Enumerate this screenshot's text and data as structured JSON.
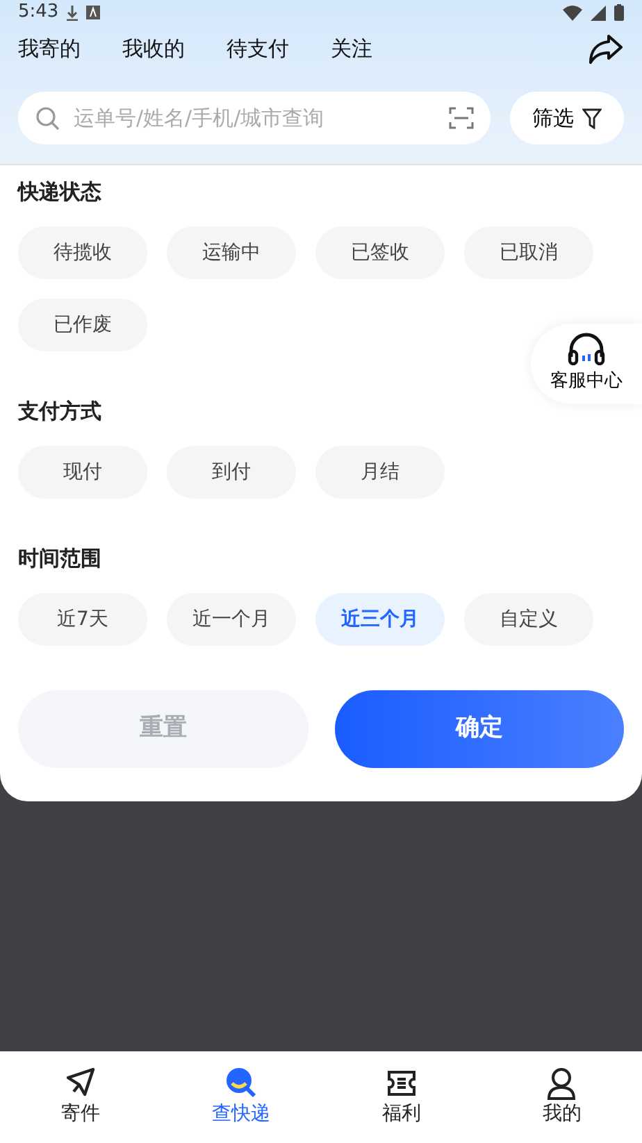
{
  "status_bar": {
    "time": "5:43"
  },
  "tabs": [
    {
      "label": "我寄的"
    },
    {
      "label": "我收的"
    },
    {
      "label": "待支付"
    },
    {
      "label": "关注"
    }
  ],
  "search": {
    "placeholder": "运单号/姓名/手机/城市查询"
  },
  "filter_button": {
    "label": "筛选"
  },
  "sections": [
    {
      "title": "快递状态",
      "options": [
        {
          "label": "待揽收",
          "selected": false
        },
        {
          "label": "运输中",
          "selected": false
        },
        {
          "label": "已签收",
          "selected": false
        },
        {
          "label": "已取消",
          "selected": false
        },
        {
          "label": "已作废",
          "selected": false
        }
      ]
    },
    {
      "title": "支付方式",
      "options": [
        {
          "label": "现付",
          "selected": false
        },
        {
          "label": "到付",
          "selected": false
        },
        {
          "label": "月结",
          "selected": false
        }
      ]
    },
    {
      "title": "时间范围",
      "options": [
        {
          "label": "近7天",
          "selected": false
        },
        {
          "label": "近一个月",
          "selected": false
        },
        {
          "label": "近三个月",
          "selected": true
        },
        {
          "label": "自定义",
          "selected": false
        }
      ]
    }
  ],
  "reset_button": {
    "label": "重置",
    "disabled": true
  },
  "confirm_button": {
    "label": "确定"
  },
  "service_button": {
    "label": "客服中心"
  },
  "bottom_nav": [
    {
      "label": "寄件",
      "kind": "send",
      "selected": false
    },
    {
      "label": "查快递",
      "kind": "track",
      "selected": true
    },
    {
      "label": "福利",
      "kind": "ticket",
      "selected": false
    },
    {
      "label": "我的",
      "kind": "user",
      "selected": false
    }
  ]
}
